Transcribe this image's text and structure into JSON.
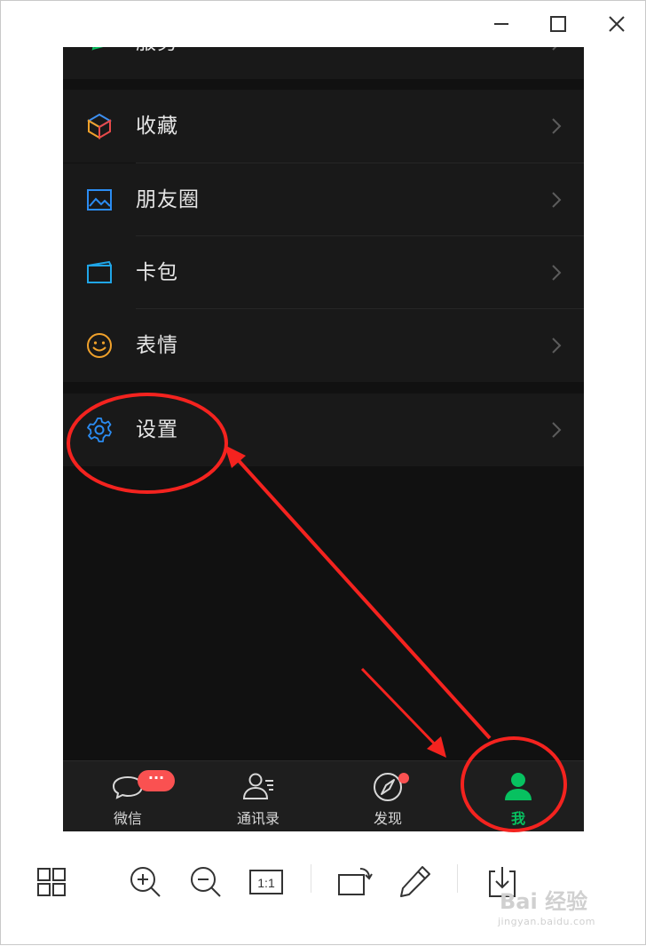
{
  "window_controls": {
    "minimize_icon": "minimize-icon",
    "maximize_icon": "maximize-icon",
    "close_icon": "close-icon"
  },
  "menu": {
    "partial_top_label": "服务",
    "items": [
      {
        "label": "收藏",
        "icon": "cube-icon"
      },
      {
        "label": "朋友圈",
        "icon": "image-icon"
      },
      {
        "label": "卡包",
        "icon": "card-icon"
      },
      {
        "label": "表情",
        "icon": "smiley-icon"
      },
      {
        "label": "设置",
        "icon": "gear-icon"
      }
    ]
  },
  "tabbar": {
    "tabs": [
      {
        "label": "微信",
        "icon": "chat-icon",
        "badge": "···"
      },
      {
        "label": "通讯录",
        "icon": "contacts-icon"
      },
      {
        "label": "发现",
        "icon": "compass-icon",
        "dot": true
      },
      {
        "label": "我",
        "icon": "person-icon",
        "active": true
      }
    ]
  },
  "viewer_toolbar": {
    "buttons": [
      "grid-icon",
      "zoom-in-icon",
      "zoom-out-icon",
      "actual-size-icon",
      "rotate-icon",
      "edit-icon",
      "download-icon"
    ],
    "actual_size_label": "1:1"
  },
  "watermark": {
    "main": "Bai 经验",
    "sub": "jingyan.baidu.com"
  },
  "colors": {
    "accent_green": "#07c160",
    "badge_red": "#fa5151",
    "annotation_red": "#f4231f"
  }
}
